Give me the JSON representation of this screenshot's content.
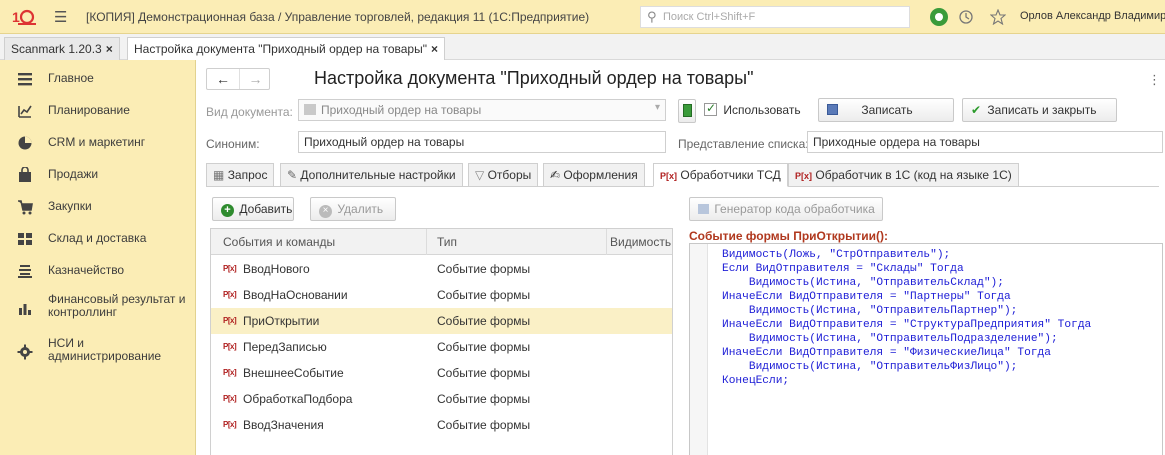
{
  "titlebar": {
    "title": "[КОПИЯ] Демонстрационная база / Управление торговлей, редакция 11  (1С:Предприятие)",
    "search_placeholder": "Поиск Ctrl+Shift+F",
    "user": "Орлов Александр Владимиров"
  },
  "window_tabs": [
    {
      "label": "Scanmark 1.20.3"
    },
    {
      "label": "Настройка документа \"Приходный ордер на товары\""
    }
  ],
  "sidebar": {
    "items": [
      {
        "label": "Главное",
        "icon": "menu-icon"
      },
      {
        "label": "Планирование",
        "icon": "planning-icon"
      },
      {
        "label": "CRM и маркетинг",
        "icon": "crm-icon"
      },
      {
        "label": "Продажи",
        "icon": "sales-bag-icon"
      },
      {
        "label": "Закупки",
        "icon": "cart-icon"
      },
      {
        "label": "Склад и доставка",
        "icon": "warehouse-icon"
      },
      {
        "label": "Казначейство",
        "icon": "treasury-icon"
      },
      {
        "label": "Финансовый результат и контроллинг",
        "icon": "chart-icon"
      },
      {
        "label": "НСИ и администрирование",
        "icon": "gear-icon"
      }
    ]
  },
  "page": {
    "title": "Настройка документа \"Приходный ордер на товары\"",
    "doc_kind_label": "Вид документа:",
    "doc_kind_value": "Приходный ордер на товары",
    "use_label": "Использовать",
    "save_label": "Записать",
    "save_close_label": "Записать и закрыть",
    "synonym_label": "Синоним:",
    "synonym_value": "Приходный ордер на товары",
    "list_repr_label": "Представление списка:",
    "list_repr_value": "Приходные ордера на товары"
  },
  "content_tabs": [
    {
      "label": "Запрос"
    },
    {
      "label": "Дополнительные настройки"
    },
    {
      "label": "Отборы"
    },
    {
      "label": "Оформления"
    },
    {
      "label": "Обработчики ТСД"
    },
    {
      "label": "Обработчик в 1С (код на языке 1С)"
    }
  ],
  "toolbar": {
    "add_label": "Добавить",
    "delete_label": "Удалить",
    "generator_label": "Генератор кода обработчика"
  },
  "table": {
    "columns": [
      "События и команды",
      "Тип",
      "Видимость"
    ],
    "rows": [
      {
        "name": "ВводНового",
        "type": "Событие формы"
      },
      {
        "name": "ВводНаОсновании",
        "type": "Событие формы"
      },
      {
        "name": "ПриОткрытии",
        "type": "Событие формы"
      },
      {
        "name": "ПередЗаписью",
        "type": "Событие формы"
      },
      {
        "name": "ВнешнееСобытие",
        "type": "Событие формы"
      },
      {
        "name": "ОбработкаПодбора",
        "type": "Событие формы"
      },
      {
        "name": "ВводЗначения",
        "type": "Событие формы"
      }
    ],
    "row_icon_text": "P[x]"
  },
  "code": {
    "title": "Событие формы ПриОткрытии():",
    "lines": [
      "Видимость(Ложь, \"СтрОтправитель\");",
      "Если ВидОтправителя = \"Склады\" Тогда",
      "    Видимость(Истина, \"ОтправительСклад\");",
      "ИначеЕсли ВидОтправителя = \"Партнеры\" Тогда",
      "    Видимость(Истина, \"ОтправительПартнер\");",
      "ИначеЕсли ВидОтправителя = \"СтруктураПредприятия\" Тогда",
      "    Видимость(Истина, \"ОтправительПодразделение\");",
      "ИначеЕсли ВидОтправителя = \"ФизическиеЛица\" Тогда",
      "    Видимость(Истина, \"ОтправительФизЛицо\");",
      "КонецЕсли;"
    ]
  },
  "colors": {
    "accent_yellow": "#fbedb5",
    "selected_row": "#faf0c6",
    "code_blue": "#1d1dd6",
    "code_title": "#b0381e",
    "green": "#3a9b3a"
  }
}
